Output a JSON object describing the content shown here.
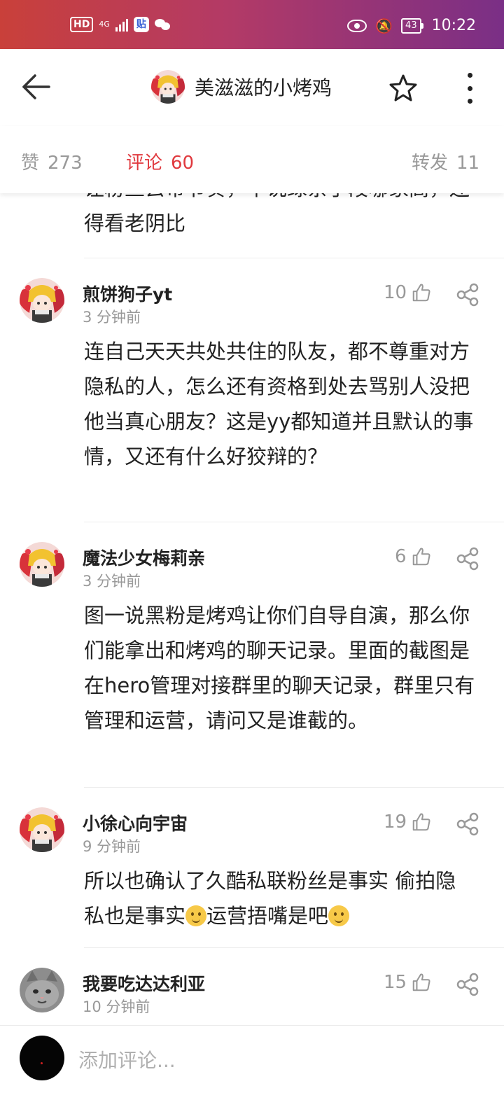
{
  "status_bar": {
    "hd": "HD",
    "network": "4G",
    "app_badge": "贴",
    "battery": "43",
    "time": "10:22"
  },
  "header": {
    "title": "美滋滋的小烤鸡"
  },
  "tabs": [
    {
      "label": "赞",
      "count": "273",
      "active": false
    },
    {
      "label": "评论",
      "count": "60",
      "active": true
    },
    {
      "label": "转发",
      "count": "11",
      "active": false
    }
  ],
  "partial_comment": {
    "text": "让粉丝去带节奏，单说绿茶手段哪家高，还得看老阴比"
  },
  "comments": [
    {
      "name": "煎饼狗子yt",
      "time": "3 分钟前",
      "likes": "10",
      "text": "连自己天天共处共住的队友，都不尊重对方隐私的人，怎么还有资格到处去骂别人没把他当真心朋友？这是yy都知道并且默认的事情，又还有什么好狡辩的？"
    },
    {
      "name": "魔法少女梅莉亲",
      "time": "3 分钟前",
      "likes": "6",
      "text": "图一说黑粉是烤鸡让你们自导自演，那么你们能拿出和烤鸡的聊天记录。里面的截图是在hero管理对接群里的聊天记录，群里只有管理和运营，请问又是谁截的。"
    },
    {
      "name": "小徐心向宇宙",
      "time": "9 分钟前",
      "likes": "19",
      "text_part1": "所以也确认了久酷私联粉丝是事实 偷拍隐私也是事实",
      "text_part2": "运营捂嘴是吧"
    },
    {
      "name": "我要吃达达利亚",
      "time": "10 分钟前",
      "likes": "15"
    }
  ],
  "bottom_bar": {
    "placeholder": "添加评论..."
  },
  "colors": {
    "accent": "#e0393e",
    "muted": "#999999"
  }
}
